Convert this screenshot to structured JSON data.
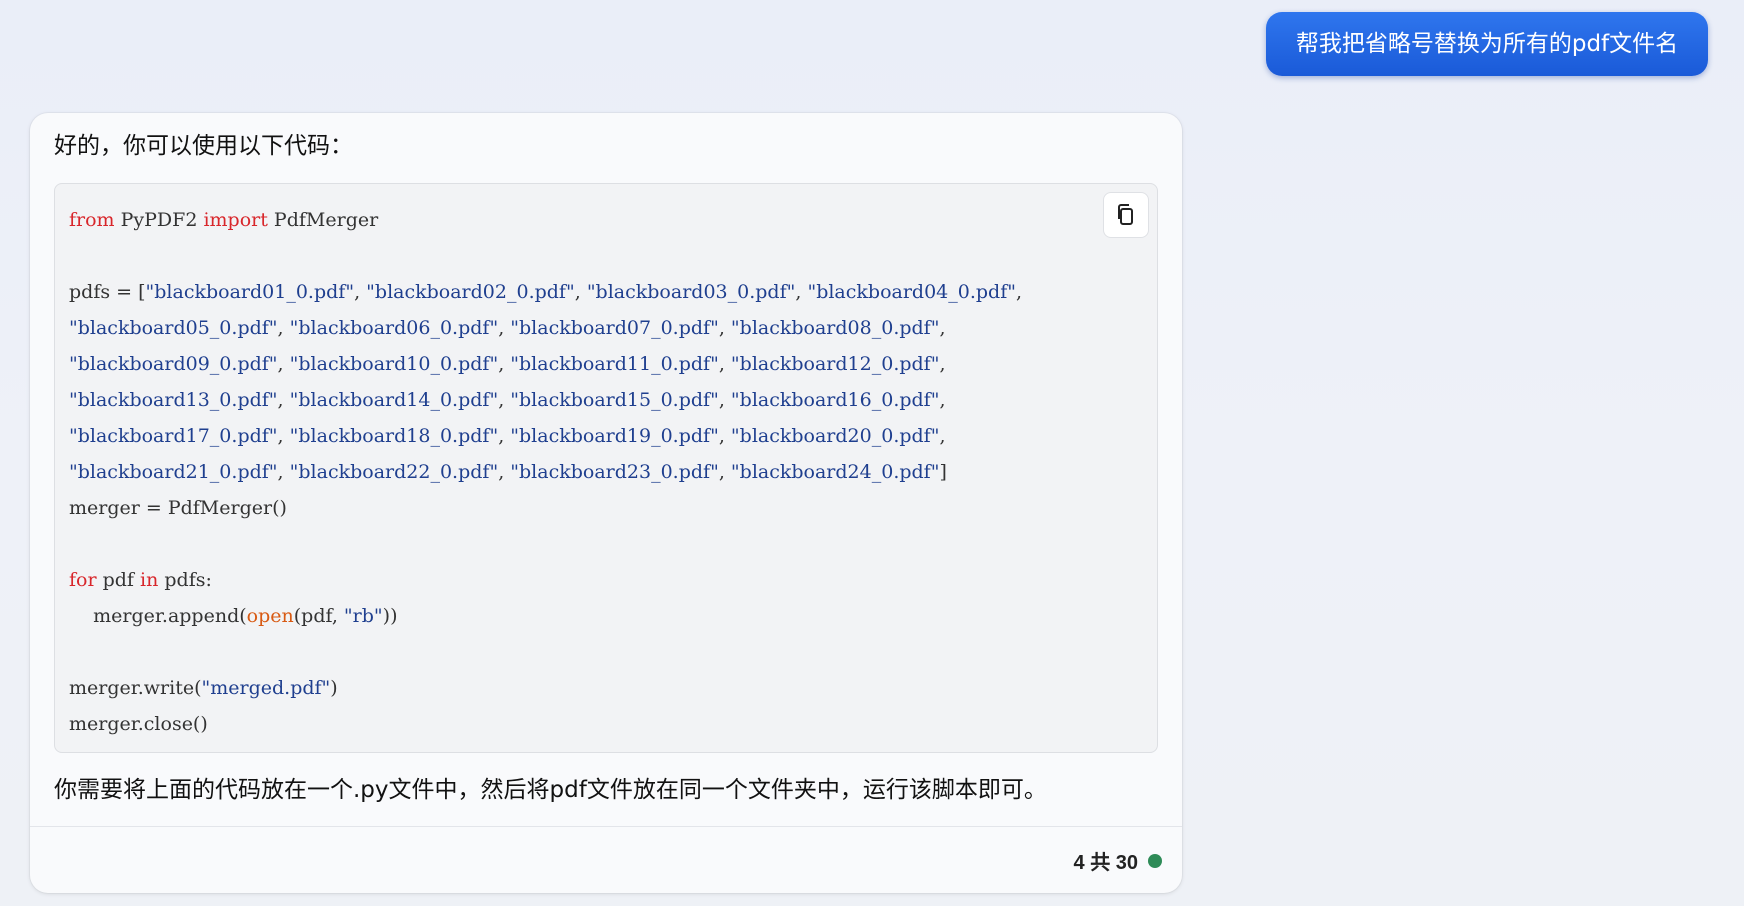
{
  "user_message": {
    "text": "帮我把省略号替换为所有的pdf文件名"
  },
  "bot_message": {
    "intro": "好的，你可以使用以下代码：",
    "outro": "你需要将上面的代码放在一个.py文件中，然后将pdf文件放在同一个文件夹中，运行该脚本即可。",
    "copy_icon": "copy-icon",
    "code": {
      "line1": {
        "kw1": "from",
        "mod": " PyPDF2 ",
        "kw2": "import",
        "name": " PdfMerger"
      },
      "pdfs_prefix": "pdfs = [",
      "pdf_lines": [
        [
          "\"blackboard01_0.pdf\"",
          "\"blackboard02_0.pdf\"",
          "\"blackboard03_0.pdf\"",
          "\"blackboard04_0.pdf\""
        ],
        [
          "\"blackboard05_0.pdf\"",
          "\"blackboard06_0.pdf\"",
          "\"blackboard07_0.pdf\"",
          "\"blackboard08_0.pdf\""
        ],
        [
          "\"blackboard09_0.pdf\"",
          "\"blackboard10_0.pdf\"",
          "\"blackboard11_0.pdf\"",
          "\"blackboard12_0.pdf\""
        ],
        [
          "\"blackboard13_0.pdf\"",
          "\"blackboard14_0.pdf\"",
          "\"blackboard15_0.pdf\"",
          "\"blackboard16_0.pdf\""
        ],
        [
          "\"blackboard17_0.pdf\"",
          "\"blackboard18_0.pdf\"",
          "\"blackboard19_0.pdf\"",
          "\"blackboard20_0.pdf\""
        ],
        [
          "\"blackboard21_0.pdf\"",
          "\"blackboard22_0.pdf\"",
          "\"blackboard23_0.pdf\"",
          "\"blackboard24_0.pdf\""
        ]
      ],
      "merger_init": "merger = PdfMerger()",
      "for_line": {
        "kw1": "for",
        "a": " pdf ",
        "kw2": "in",
        "b": " pdfs:"
      },
      "append_line": {
        "a": "    merger.append(",
        "fn": "open",
        "b": "(pdf, ",
        "str": "\"rb\"",
        "c": "))"
      },
      "write_line": {
        "a": "merger.write(",
        "str": "\"merged.pdf\"",
        "b": ")"
      },
      "close_line": "merger.close()"
    },
    "footer": {
      "page_text": "4 共 30",
      "status_color": "#2e8b57"
    }
  }
}
